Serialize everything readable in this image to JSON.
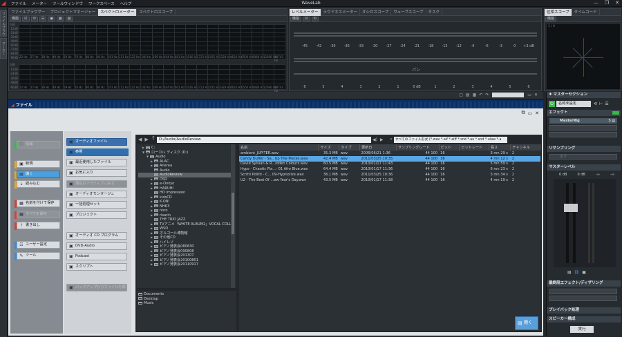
{
  "app": {
    "title": "WaveLab",
    "menu": [
      "ファイル",
      "メーター",
      "ツールウィンドウ",
      "ワークスペース",
      "ヘルプ"
    ],
    "window_controls": [
      "—",
      "❐",
      "✕"
    ]
  },
  "left_rail": {
    "tabs": [
      "ファイルブラウザー",
      "マーカー"
    ]
  },
  "top_left_panel": {
    "tabs": [
      "ファイルブラウザー",
      "プロジェクトマネージャー",
      "スペクトロメーター",
      "スペクトロスコープ"
    ],
    "active_tab": 2,
    "toolbar_label": "機能",
    "db_labels": [
      "0dB",
      "-12dB",
      "-24dB",
      "-36dB",
      "-48dB",
      "-60dB",
      "-72dB",
      "-84dB",
      "-96dB"
    ],
    "hz_labels": [
      "22 Hz",
      "27 Hz",
      "38 Hz",
      "49 Hz",
      "59 Hz",
      "70 Hz",
      "80 Hz",
      "90 Hz",
      "101 Hz",
      "111 Hz",
      "122 Hz",
      "140 Hz",
      "269 Hz",
      "404 Hz",
      "601 Hz",
      "1016 Hz",
      "1723 Hz",
      "2425 Hz",
      "3328 Hz",
      "4624 Hz",
      "6500 Hz",
      "9086 Hz",
      "12666 Hz",
      "18743 Hz"
    ]
  },
  "level_panel": {
    "tabs": [
      "レベルメーター",
      "ラウドネスメーター",
      "オシロスコープ",
      "ウェーブスコープ",
      "タスク"
    ],
    "active_tab": 0,
    "toolbar_label": "機能",
    "db_scale": [
      "-45",
      "-42",
      "-39",
      "-36",
      "-33",
      "-30",
      "-27",
      "-24",
      "-21",
      "-18",
      "-15",
      "-12",
      "-9",
      "-6",
      "-3",
      "0",
      "+3 dB"
    ],
    "pan_label": "パン",
    "pan_scale": [
      "6",
      "5",
      "4",
      "3",
      "2",
      "1",
      "0 dB",
      "1",
      "2",
      "3",
      "4",
      "5",
      "6"
    ]
  },
  "phase_panel": {
    "tabs": [
      "位相スコープ",
      "タイムコード"
    ],
    "active_tab": 0,
    "toolbar_label": "機能",
    "scale": "1 / 0"
  },
  "file_dialog": {
    "tab": "ファイル",
    "left_nav": [
      {
        "label": "情報",
        "icon": "ⓘ",
        "state": "dis",
        "mark": "#38b848"
      },
      {
        "label": "新規",
        "icon": "▣",
        "state": "",
        "mark": "#e8a820"
      },
      {
        "label": "開く",
        "icon": "▤",
        "state": "sel",
        "mark": "#e8a820"
      },
      {
        "label": "読み込む",
        "icon": "⇣",
        "state": "",
        "mark": "#e8a820"
      },
      {
        "label": "名前を付けて保存",
        "icon": "▦",
        "state": "",
        "mark": "#d84030"
      },
      {
        "label": "すべてを保存",
        "icon": "▦",
        "state": "dis",
        "mark": "#d84030"
      },
      {
        "label": "書き出し",
        "icon": "⇡",
        "state": "",
        "mark": "#d84030"
      },
      {
        "label": "ユーザー設定",
        "icon": "☷",
        "state": "",
        "mark": "#3090e0"
      },
      {
        "label": "ツール",
        "icon": "✎",
        "state": "",
        "mark": "#3090e0"
      }
    ],
    "sub_nav": [
      {
        "label": "オーディオファイル",
        "type": "header"
      },
      {
        "label": "参照",
        "state": "sel"
      },
      {
        "label": "最近使用したファイル",
        "state": ""
      },
      {
        "label": "お気に入り",
        "state": ""
      },
      {
        "label": "現在のアクティブに戻す",
        "state": "dis"
      },
      {
        "label": "オーディオモンタージュ",
        "state": ""
      },
      {
        "label": "一括処理セット",
        "state": ""
      },
      {
        "label": "プロジェクト",
        "state": ""
      },
      {
        "label": "オーディオ CD プログラム",
        "state": ""
      },
      {
        "label": "DVD-Audio",
        "state": ""
      },
      {
        "label": "Podcast",
        "state": ""
      },
      {
        "label": "スクリプト",
        "state": ""
      },
      {
        "label": "バックアップからファイルを開く",
        "state": "dis"
      }
    ],
    "path": "D:/Audio/AudioReview",
    "filter": "すべてのファイル形式 (*.wav *.aif *.aiff *.snd *.au *.snd *.ulaw *.a",
    "tree": [
      {
        "label": "C:",
        "indent": 1,
        "arrow": "▶"
      },
      {
        "label": "ローカル ディスク (D:)",
        "indent": 1,
        "arrow": "▼"
      },
      {
        "label": "Audio",
        "indent": 2,
        "arrow": "▼"
      },
      {
        "label": "ALAC",
        "indent": 3,
        "arrow": "▶"
      },
      {
        "label": "Anerea",
        "indent": 3,
        "arrow": "▶"
      },
      {
        "label": "Audio",
        "indent": 3,
        "arrow": ""
      },
      {
        "label": "AudioReview",
        "indent": 3,
        "arrow": "",
        "sel": true
      },
      {
        "label": "DSD",
        "indent": 3,
        "arrow": "▶"
      },
      {
        "label": "e-Onkyo",
        "indent": 3,
        "arrow": "▶"
      },
      {
        "label": "HARUHI",
        "indent": 3,
        "arrow": "▶"
      },
      {
        "label": "HD Impression",
        "indent": 3,
        "arrow": ""
      },
      {
        "label": "kidsCD",
        "indent": 3,
        "arrow": "▶"
      },
      {
        "label": "K-ON!",
        "indent": 3,
        "arrow": "▶"
      },
      {
        "label": "NHK3",
        "indent": 3,
        "arrow": "▶"
      },
      {
        "label": "noro",
        "indent": 3,
        "arrow": "▶"
      },
      {
        "label": "risarin",
        "indent": 3,
        "arrow": "▶"
      },
      {
        "label": "THE TRIO JAZZ",
        "indent": 3,
        "arrow": ""
      },
      {
        "label": "TVアニメ「WHITE ALBUM2」VOCAL COLL",
        "indent": 3,
        "arrow": "▶"
      },
      {
        "label": "WSD",
        "indent": 3,
        "arrow": "▶"
      },
      {
        "label": "オルゴール博物館",
        "indent": 3,
        "arrow": "▶"
      },
      {
        "label": "その他CD",
        "indent": 3,
        "arrow": "▶"
      },
      {
        "label": "ハイレゾ",
        "indent": 3,
        "arrow": "▶"
      },
      {
        "label": "ピアノ発表会080830",
        "indent": 3,
        "arrow": "▶"
      },
      {
        "label": "ピアノ発表会090808",
        "indent": 3,
        "arrow": "▶"
      },
      {
        "label": "ピアノ発表会201307",
        "indent": 3,
        "arrow": "▶"
      },
      {
        "label": "ピアノ発表会20100801",
        "indent": 3,
        "arrow": "▶"
      },
      {
        "label": "ピアノ発表会20110917",
        "indent": 3,
        "arrow": "▶"
      }
    ],
    "places": [
      "Documents",
      "Desktop",
      "Music"
    ],
    "columns": [
      "名前",
      "サイズ",
      "タイプ",
      "更新日",
      "サンプリングレート",
      "ビット",
      "ビットレート",
      "長さ",
      "チャンネル"
    ],
    "files": [
      [
        "ambient_JUPITER.wav",
        "35.3 MB",
        "wav",
        "2006/06/21 1:36",
        "44 100",
        "16",
        "",
        "3 mn 29 s",
        "2"
      ],
      [
        "Candy Dulfer - Sa...Up The Pieces.wav",
        "42.4 MB",
        "wav",
        "2011/03/25 10:35",
        "44 100",
        "16",
        "",
        "4 mn 12 s",
        "2"
      ],
      [
        "David Sylvian & R...idden Colours.wav",
        "60.5 MB",
        "wav",
        "2010/01/17 11:43",
        "44 100",
        "16",
        "",
        "5 mn 59 s",
        "2"
      ],
      [
        "Hyps - Chaotic Pla...- 01 Afro Blue.wav",
        "64.4 MB",
        "wav",
        "2010/01/17 11:36",
        "44 100",
        "16",
        "",
        "6 mn 23 s",
        "2"
      ],
      [
        "Scritti Politti - C... 09-Hypnotize.wav",
        "36.1 MB",
        "wav",
        "2011/03/25 10:36",
        "44 100",
        "16",
        "",
        "3 mn 34 s",
        "2"
      ],
      [
        "U2 - The Best Of ...ew Year's Day.wav",
        "43.5 MB",
        "wav",
        "2010/01/17 11:38",
        "44 100",
        "16",
        "",
        "4 mn 19 s",
        "2"
      ]
    ],
    "selected_file": 1,
    "open_button": "開く"
  },
  "master": {
    "title": "マスターセクション",
    "preset": "名称未設定",
    "effects_title": "エフェクト",
    "masterrig": "MasterRig",
    "resampling_title": "リサンプリング",
    "resampling_value": "オフ",
    "master_level_title": "マスターレベル",
    "level_values": [
      "0 dB",
      "0 dB",
      "-∞",
      "-∞"
    ],
    "final_title": "最終段エフェクト/ディザリング",
    "playback_title": "プレイバック処理",
    "speaker_title": "スピーカー構成",
    "render_button": "実行"
  },
  "colors": {
    "accent": "#5aa7e6",
    "bg": "#23272b",
    "green": "#38b848",
    "orange": "#e8a820",
    "red": "#d84030",
    "blue": "#3090e0"
  }
}
